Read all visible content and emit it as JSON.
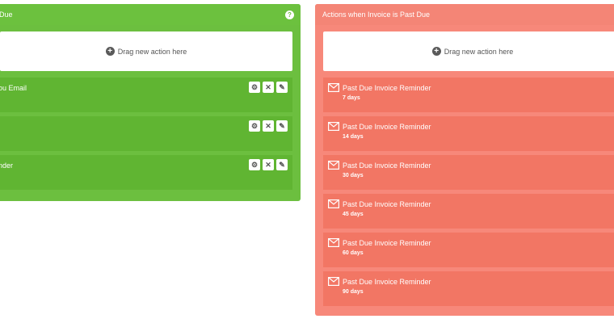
{
  "left_panel": {
    "title": "s Due",
    "help_icon": "question-icon",
    "dropzone_label": "Drag new action here",
    "actions": [
      {
        "label": "ou Email"
      },
      {
        "label": ""
      },
      {
        "label": "nder"
      }
    ],
    "colors": {
      "panel": "#6cbf3f",
      "action": "#60b532"
    }
  },
  "right_panel": {
    "title": "Actions when Invoice is Past Due",
    "dropzone_label": "Drag new action here",
    "actions": [
      {
        "label": "Past Due Invoice Reminder",
        "delay": "7 days"
      },
      {
        "label": "Past Due Invoice Reminder",
        "delay": "14 days"
      },
      {
        "label": "Past Due Invoice Reminder",
        "delay": "30 days"
      },
      {
        "label": "Past Due Invoice Reminder",
        "delay": "45 days"
      },
      {
        "label": "Past Due Invoice Reminder",
        "delay": "60 days"
      },
      {
        "label": "Past Due Invoice Reminder",
        "delay": "90 days"
      }
    ],
    "colors": {
      "panel": "#f7887a",
      "action": "#f27664"
    }
  },
  "icons": {
    "tool_icons": [
      "gear-icon",
      "close-icon",
      "pencil-icon"
    ],
    "action_icon": "envelope-icon",
    "dropzone_icon": "plus-circle-icon"
  }
}
